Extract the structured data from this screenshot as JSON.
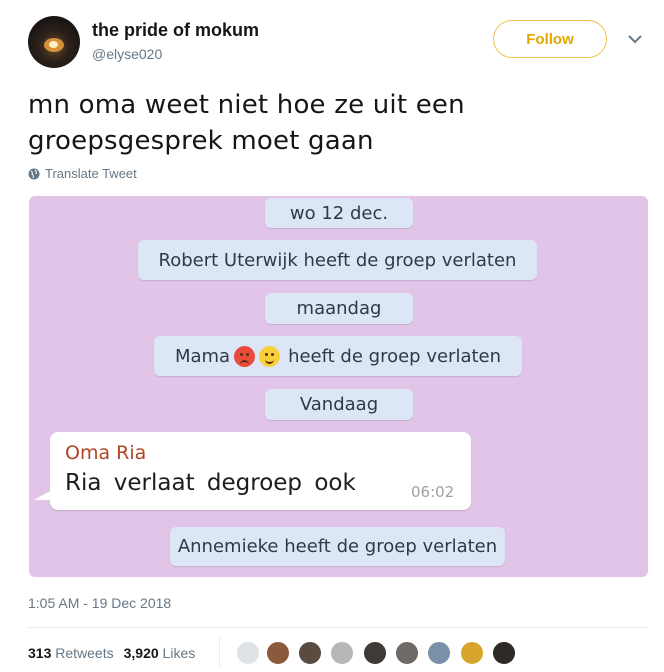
{
  "tweet": {
    "display_name": "the pride of mokum",
    "handle": "@elyse020",
    "follow_label": "Follow",
    "text_line1": "mn oma weet niet hoe ze uit een",
    "text_line2": "groepsgesprek moet gaan",
    "translate_label": "Translate Tweet",
    "timestamp": "1:05 AM - 19 Dec 2018",
    "retweets_count": "313",
    "retweets_label": "Retweets",
    "likes_count": "3,920",
    "likes_label": "Likes"
  },
  "chat": {
    "background_color": "#e2c4e8",
    "date_1": "wo 12 dec.",
    "system_1": "Robert Uterwijk heeft de groep verlaten",
    "date_2": "maandag",
    "system_2_name": "Mama",
    "system_2_rest": "heeft de groep verlaten",
    "date_3": "Vandaag",
    "message": {
      "sender": "Oma Ria",
      "text": "Ria verlaat degroep ook",
      "time": "06:02"
    },
    "system_3": "Annemieke heeft de groep verlaten"
  },
  "colors": {
    "follow_accent": "#e0a800",
    "sender_name": "#b14424",
    "chip_bg": "#dce6f6"
  }
}
